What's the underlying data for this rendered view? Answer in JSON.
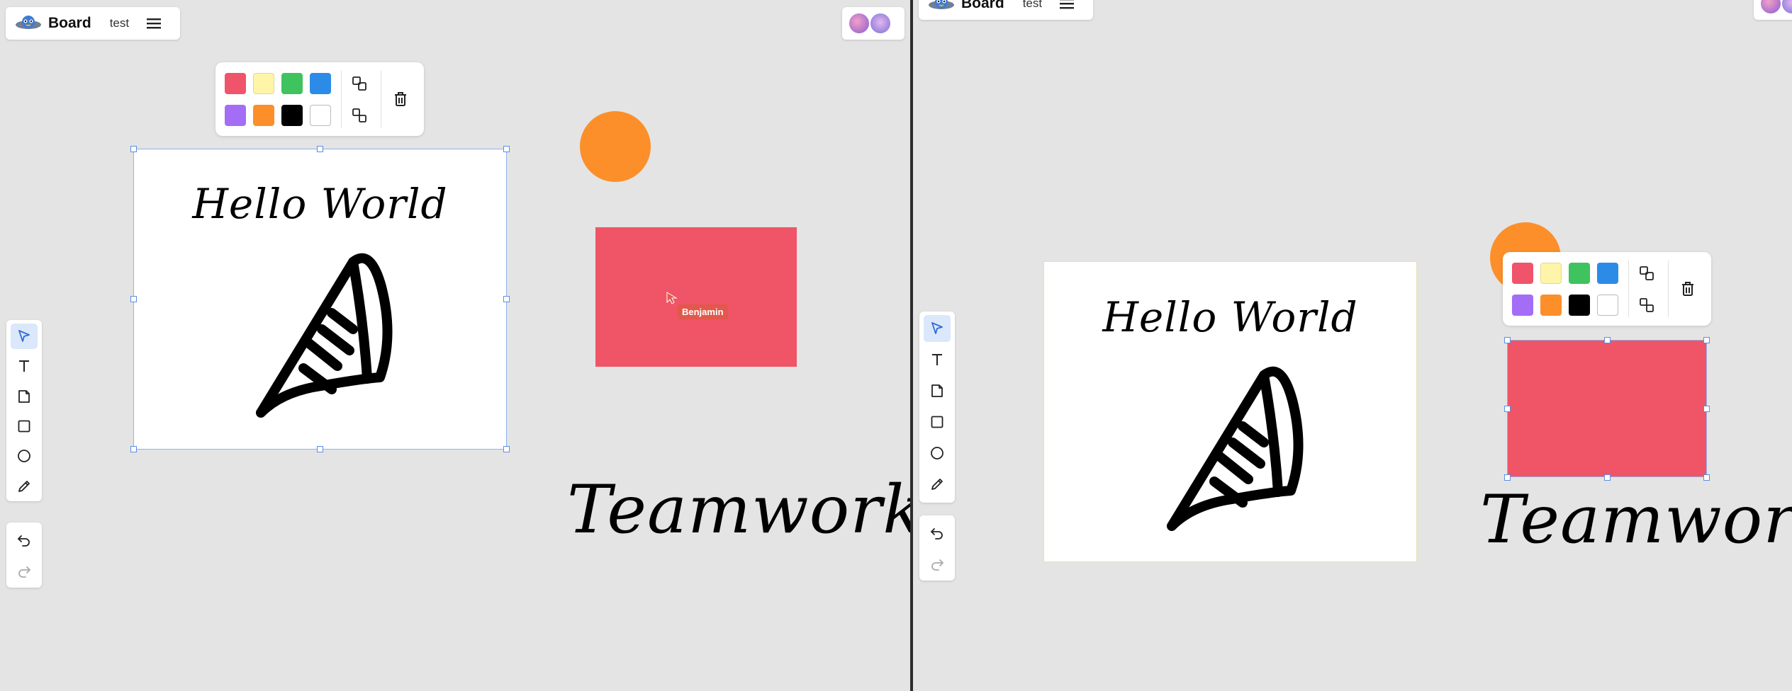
{
  "app": {
    "title": "Board",
    "board_name": "test"
  },
  "colors": {
    "swatches": [
      "#f0546a",
      "#fff5a8",
      "#3fc35e",
      "#2d8be8",
      "#a36ef5",
      "#fc8f2a",
      "#000000",
      "#ffffff"
    ],
    "shape_orange": "#fc8f2a",
    "shape_red": "#f05467",
    "selection": "#5b8ee6",
    "tool_active_bg": "#dbe7fb",
    "cursor_label_bg": "#e2584c"
  },
  "toolbar": {
    "tools": [
      "select-icon",
      "text-icon",
      "sticky-note-icon",
      "rectangle-icon",
      "circle-icon",
      "pen-icon"
    ],
    "history": [
      "undo-icon",
      "redo-icon"
    ]
  },
  "color_panel": {
    "actions": [
      "bring-forward-icon",
      "send-backward-icon"
    ],
    "delete": "trash-icon"
  },
  "canvas": {
    "frame_text": "Hello World",
    "teamwork_text": "Teamwork!",
    "frame_drawing": "party-horn-sketch"
  },
  "cursor": {
    "label": "Benjamin"
  },
  "avatars": [
    "avatar-1",
    "avatar-2"
  ]
}
